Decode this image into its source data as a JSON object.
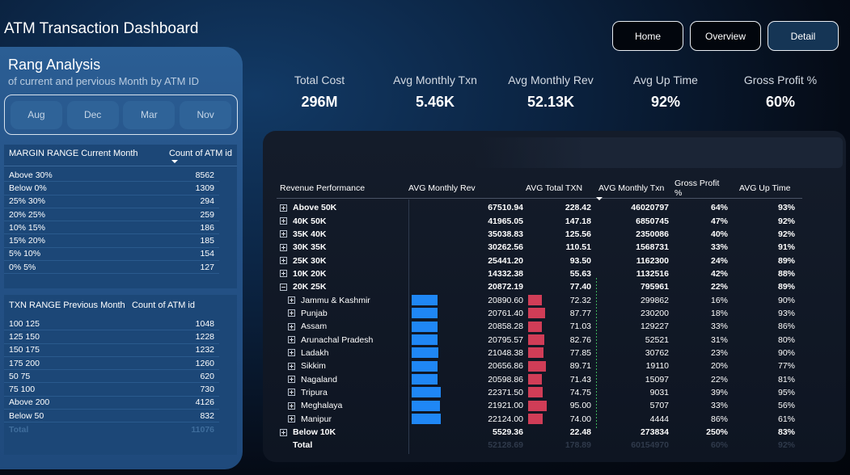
{
  "app_title": "ATM Transaction Dashboard",
  "nav": {
    "home": "Home",
    "overview": "Overview",
    "detail": "Detail"
  },
  "left_panel": {
    "title": "Rang Analysis",
    "subtitle": "of current and pervious Month by ATM ID",
    "months": [
      "Aug",
      "Dec",
      "Mar",
      "Nov"
    ],
    "margin_table": {
      "header_left": "MARGIN RANGE Current Month",
      "header_right": "Count of ATM id",
      "rows": [
        {
          "label": "Above 30%",
          "count": "8562"
        },
        {
          "label": "Below 0%",
          "count": "1309"
        },
        {
          "label": "25% 30%",
          "count": "294"
        },
        {
          "label": "20% 25%",
          "count": "259"
        },
        {
          "label": "10% 15%",
          "count": "186"
        },
        {
          "label": "15% 20%",
          "count": "185"
        },
        {
          "label": "5% 10%",
          "count": "154"
        },
        {
          "label": "0% 5%",
          "count": "127"
        }
      ]
    },
    "txn_table": {
      "header_left": "TXN RANGE Previous Month",
      "header_right": "Count of ATM id",
      "rows": [
        {
          "label": "100 125",
          "count": "1048"
        },
        {
          "label": "125 150",
          "count": "1228"
        },
        {
          "label": "150 175",
          "count": "1232"
        },
        {
          "label": "175 200",
          "count": "1260"
        },
        {
          "label": "50 75",
          "count": "620"
        },
        {
          "label": "75 100",
          "count": "730"
        },
        {
          "label": "Above 200",
          "count": "4126"
        },
        {
          "label": "Below 50",
          "count": "832"
        }
      ],
      "total_label": "Total",
      "total_count": "11076"
    }
  },
  "kpis": [
    {
      "label": "Total Cost",
      "value": "296M"
    },
    {
      "label": "Avg Monthly Txn",
      "value": "5.46K"
    },
    {
      "label": "Avg Monthly Rev",
      "value": "52.13K"
    },
    {
      "label": "Avg Up Time",
      "value": "92%"
    },
    {
      "label": "Gross Profit %",
      "value": "60%"
    }
  ],
  "matrix": {
    "headers": [
      "Revenue Performance",
      "AVG Monthly Rev",
      "AVG Total TXN",
      "AVG Monthly Txn",
      "Gross Profit %",
      "AVG Up Time"
    ],
    "groups_top": [
      {
        "label": "Above 50K",
        "rev": "67510.94",
        "txn": "228.42",
        "mtxn": "46020797",
        "gp": "64%",
        "up": "93%"
      },
      {
        "label": "40K 50K",
        "rev": "41965.05",
        "txn": "147.18",
        "mtxn": "6850745",
        "gp": "47%",
        "up": "92%"
      },
      {
        "label": "35K 40K",
        "rev": "35038.83",
        "txn": "125.56",
        "mtxn": "2350086",
        "gp": "40%",
        "up": "92%"
      },
      {
        "label": "30K 35K",
        "rev": "30262.56",
        "txn": "110.51",
        "mtxn": "1568731",
        "gp": "33%",
        "up": "91%"
      },
      {
        "label": "25K 30K",
        "rev": "25441.20",
        "txn": "93.50",
        "mtxn": "1162300",
        "gp": "24%",
        "up": "89%"
      },
      {
        "label": "10K 20K",
        "rev": "14332.38",
        "txn": "55.63",
        "mtxn": "1132516",
        "gp": "42%",
        "up": "88%"
      }
    ],
    "expanded_group": {
      "label": "20K 25K",
      "rev": "20872.19",
      "txn": "77.40",
      "mtxn": "795961",
      "gp": "22%",
      "up": "89%"
    },
    "children": [
      {
        "label": "Jammu & Kashmir",
        "rev": "20890.60",
        "txn": "72.32",
        "mtxn": "299862",
        "gp": "16%",
        "up": "90%"
      },
      {
        "label": "Punjab",
        "rev": "20761.40",
        "txn": "87.77",
        "mtxn": "230200",
        "gp": "18%",
        "up": "93%"
      },
      {
        "label": "Assam",
        "rev": "20858.28",
        "txn": "71.03",
        "mtxn": "129227",
        "gp": "33%",
        "up": "86%"
      },
      {
        "label": "Arunachal Pradesh",
        "rev": "20795.57",
        "txn": "82.76",
        "mtxn": "52521",
        "gp": "31%",
        "up": "80%"
      },
      {
        "label": "Ladakh",
        "rev": "21048.38",
        "txn": "77.85",
        "mtxn": "30762",
        "gp": "23%",
        "up": "90%"
      },
      {
        "label": "Sikkim",
        "rev": "20656.86",
        "txn": "89.71",
        "mtxn": "19110",
        "gp": "20%",
        "up": "77%"
      },
      {
        "label": "Nagaland",
        "rev": "20598.86",
        "txn": "71.43",
        "mtxn": "15097",
        "gp": "22%",
        "up": "81%"
      },
      {
        "label": "Tripura",
        "rev": "22371.50",
        "txn": "74.75",
        "mtxn": "9031",
        "gp": "39%",
        "up": "95%"
      },
      {
        "label": "Meghalaya",
        "rev": "21921.00",
        "txn": "95.00",
        "mtxn": "5707",
        "gp": "33%",
        "up": "56%"
      },
      {
        "label": "Manipur",
        "rev": "22124.00",
        "txn": "74.00",
        "mtxn": "4444",
        "gp": "86%",
        "up": "61%"
      }
    ],
    "groups_bottom": [
      {
        "label": "Below 10K",
        "rev": "5529.36",
        "txn": "22.48",
        "mtxn": "273834",
        "gp": "250%",
        "up": "83%"
      }
    ],
    "total": {
      "label": "Total",
      "rev": "52128.69",
      "txn": "178.89",
      "mtxn": "60154970",
      "gp": "60%",
      "up": "92%"
    },
    "bar_colors": {
      "rev": "#1f87f5",
      "txn": "#d03d57"
    }
  }
}
